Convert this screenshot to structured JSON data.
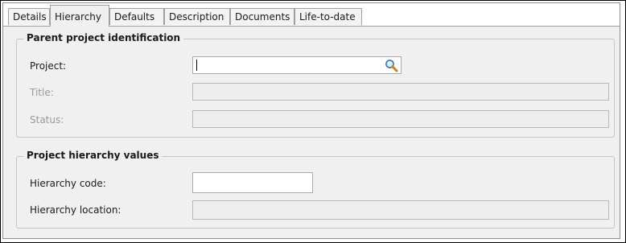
{
  "tabs": [
    {
      "label": "Details",
      "active": false
    },
    {
      "label": "Hierarchy",
      "active": true
    },
    {
      "label": "Defaults",
      "active": false
    },
    {
      "label": "Description",
      "active": false
    },
    {
      "label": "Documents",
      "active": false
    },
    {
      "label": "Life-to-date",
      "active": false
    }
  ],
  "parent_group": {
    "title": "Parent project identification",
    "project_label": "Project:",
    "project_value": "",
    "title_label": "Title:",
    "title_value": "",
    "status_label": "Status:",
    "status_value": ""
  },
  "hierarchy_group": {
    "title": "Project hierarchy values",
    "code_label": "Hierarchy code:",
    "code_value": "",
    "location_label": "Hierarchy location:",
    "location_value": ""
  },
  "icons": {
    "search": "magnifier-icon"
  },
  "colors": {
    "panel_bg": "#f0f0f0",
    "disabled_text": "#9a9a9a",
    "disabled_field": "#eeeeee"
  }
}
